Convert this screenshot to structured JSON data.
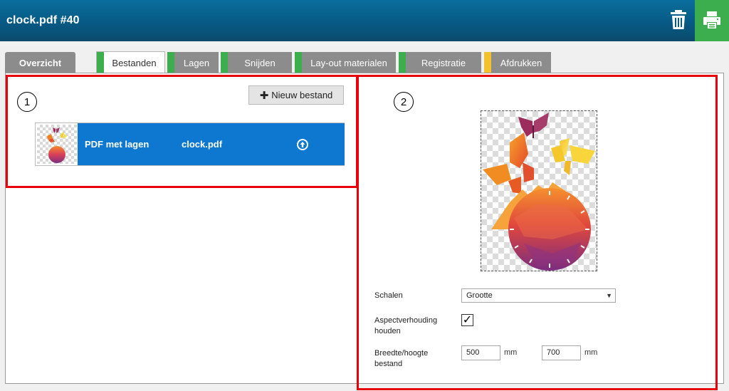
{
  "header": {
    "title": "clock.pdf #40",
    "icons": {
      "delete": "trash-icon",
      "print": "printer-icon"
    },
    "colors": {
      "bar": "#075a85",
      "print_button": "#3dae4e"
    }
  },
  "tabs": [
    {
      "label": "Overzicht",
      "status": "none"
    },
    {
      "label": "Bestanden",
      "status": "green",
      "active": true
    },
    {
      "label": "Lagen",
      "status": "green"
    },
    {
      "label": "Snijden",
      "status": "green"
    },
    {
      "label": "Lay-out materialen",
      "status": "green"
    },
    {
      "label": "Registratie",
      "status": "green"
    },
    {
      "label": "Afdrukken",
      "status": "yellow"
    }
  ],
  "files_panel": {
    "marker": "1",
    "new_file_label": "Nieuw bestand",
    "files": [
      {
        "type": "PDF met lagen",
        "name": "clock.pdf",
        "action_icon": "upload-circle-icon"
      }
    ],
    "colors": {
      "selected_row": "#0e78d0"
    }
  },
  "detail_panel": {
    "marker": "2",
    "scale_label": "Schalen",
    "scale_value": "Grootte",
    "aspect_label_line1": "Aspectverhouding",
    "aspect_label_line2": "houden",
    "aspect_checked_mark": "✓",
    "size_label_line1": "Breedte/hoogte",
    "size_label_line2": "bestand",
    "width_value": "500",
    "height_value": "700",
    "unit": "mm"
  },
  "highlight_color": "#e8000b"
}
